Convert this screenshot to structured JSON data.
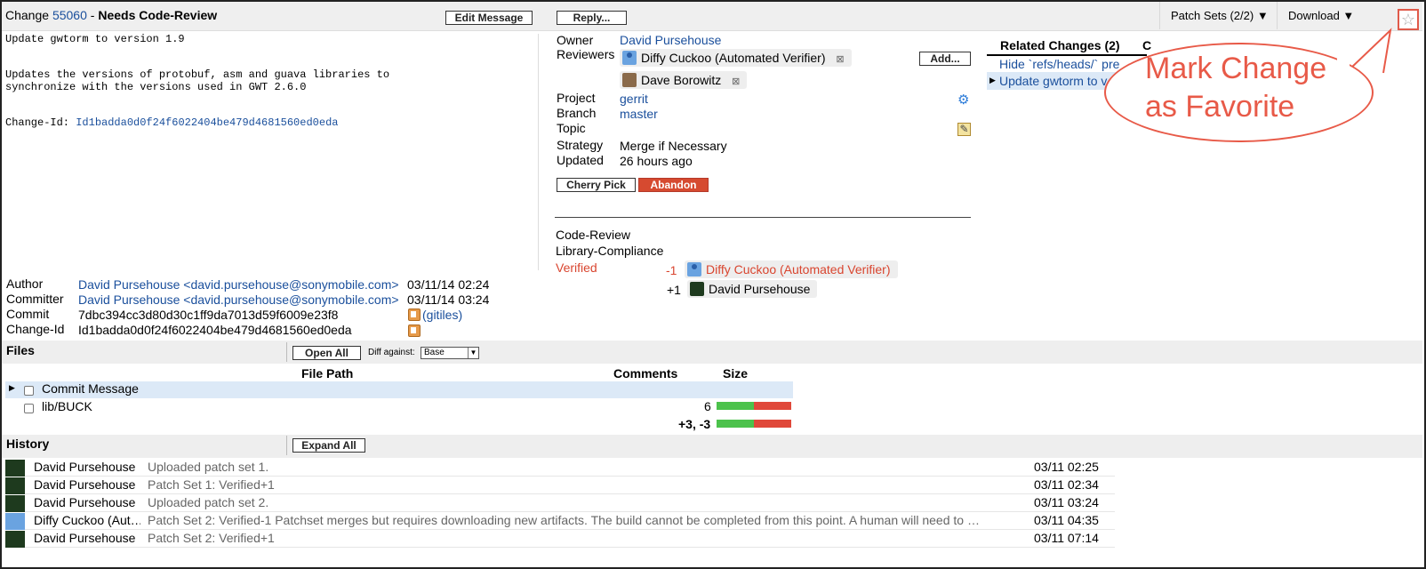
{
  "header": {
    "change_prefix": "Change",
    "change_number": "55060",
    "separator": "-",
    "status": "Needs Code-Review",
    "edit_message_label": "Edit Message",
    "reply_label": "Reply...",
    "patch_sets_label": "Patch Sets (2/2) ▼",
    "download_label": "Download ▼",
    "star_icon": "☆"
  },
  "commit_message": {
    "subject": "Update gwtorm to version 1.9",
    "body_line1": "Updates the versions of protobuf, asm and guava libraries to",
    "body_line2": "synchronize with the versions used in GWT 2.6.0",
    "change_id_label": "Change-Id:",
    "change_id_value": "Id1badda0d0f24f6022404be479d4681560ed0eda"
  },
  "change_info": {
    "owner_label": "Owner",
    "owner_value": "David Pursehouse",
    "reviewers_label": "Reviewers",
    "reviewers": [
      "Diffy Cuckoo (Automated Verifier)",
      "Dave Borowitz"
    ],
    "remove_mark": "⊠",
    "add_label": "Add...",
    "project_label": "Project",
    "project_value": "gerrit",
    "branch_label": "Branch",
    "branch_value": "master",
    "topic_label": "Topic",
    "topic_value": "",
    "strategy_label": "Strategy",
    "strategy_value": "Merge if Necessary",
    "updated_label": "Updated",
    "updated_value": "26 hours ago",
    "cherry_pick_label": "Cherry Pick",
    "abandon_label": "Abandon",
    "gear_icon": "⚙",
    "edit_icon": "✎"
  },
  "labels": {
    "code_review": "Code-Review",
    "library_compliance": "Library-Compliance",
    "verified": "Verified",
    "votes": [
      {
        "score": "-1",
        "name": "Diffy Cuckoo (Automated Verifier)"
      },
      {
        "score": "+1",
        "name": "David Pursehouse"
      }
    ]
  },
  "related": {
    "title": "Related Changes (2)",
    "second_tab_initial": "C",
    "items": [
      "Hide `refs/heads/` pre",
      "Update gwtorm to v"
    ],
    "selected_marker": "▶"
  },
  "callout": {
    "line1": "Mark Change",
    "line2": "as Favorite"
  },
  "commit_info": {
    "author_label": "Author",
    "author_value": "David Pursehouse <david.pursehouse@sonymobile.com>",
    "author_date": "03/11/14 02:24",
    "committer_label": "Committer",
    "committer_value": "David Pursehouse <david.pursehouse@sonymobile.com>",
    "committer_date": "03/11/14 03:24",
    "commit_label": "Commit",
    "commit_value": "7dbc394cc3d80d30c1ff9da7013d59f6009e23f8",
    "gitiles_label": "(gitiles)",
    "change_id_label": "Change-Id",
    "change_id_value": "Id1badda0d0f24f6022404be479d4681560ed0eda"
  },
  "files": {
    "title": "Files",
    "open_all_label": "Open All",
    "diff_against_label": "Diff against:",
    "diff_against_value": "Base",
    "col_path": "File Path",
    "col_comments": "Comments",
    "col_size": "Size",
    "expand_marker": "▶",
    "rows": [
      {
        "path": "Commit Message",
        "count": ""
      },
      {
        "path": "lib/BUCK",
        "count": "6"
      }
    ],
    "total": "+3, -3",
    "size_ratio_added": 0.5
  },
  "history": {
    "title": "History",
    "expand_all_label": "Expand All",
    "rows": [
      {
        "name": "David Pursehouse",
        "message": "Uploaded patch set 1.",
        "time": "03/11 02:25",
        "avatar": "green"
      },
      {
        "name": "David Pursehouse",
        "message": "Patch Set 1: Verified+1",
        "time": "03/11 02:34",
        "avatar": "green"
      },
      {
        "name": "David Pursehouse",
        "message": "Uploaded patch set 2.",
        "time": "03/11 03:24",
        "avatar": "green"
      },
      {
        "name": "Diffy Cuckoo (Aut…",
        "message": "Patch Set 2: Verified-1 Patchset merges but requires downloading new artifacts. The build cannot be completed from this point. A human will need to p…",
        "time": "03/11 04:35",
        "avatar": "blue"
      },
      {
        "name": "David Pursehouse",
        "message": "Patch Set 2: Verified+1",
        "time": "03/11 07:14",
        "avatar": "green"
      }
    ]
  },
  "colors": {
    "link": "#1a4f9c",
    "abandon": "#d64a30",
    "callout": "#e85a48",
    "verified_red": "#d9452f",
    "size_added": "#4cc24c",
    "size_removed": "#e0483a"
  }
}
